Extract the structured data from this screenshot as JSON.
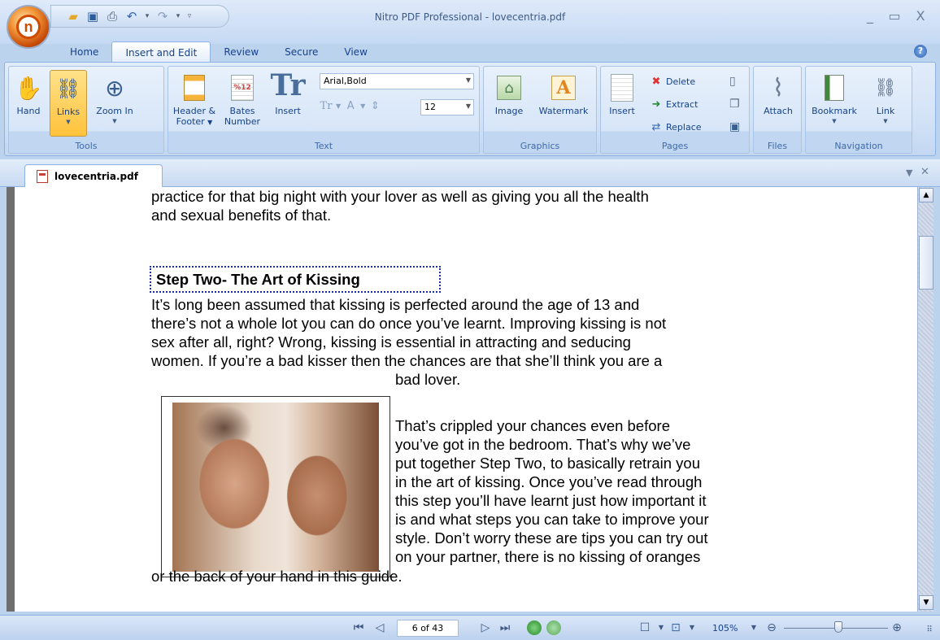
{
  "window": {
    "title": "Nitro PDF Professional - lovecentria.pdf",
    "app_logo": "n",
    "controls": [
      "_",
      "▭",
      "X"
    ]
  },
  "quick_access": {
    "icons": [
      "open-folder-icon",
      "save-icon",
      "print-icon",
      "undo-icon",
      "redo-icon",
      "customize-icon"
    ]
  },
  "ribbon_tabs": [
    "Home",
    "Insert and Edit",
    "Review",
    "Secure",
    "View"
  ],
  "active_tab": "Insert and Edit",
  "ribbon": {
    "tools": {
      "label": "Tools",
      "hand": "Hand",
      "links": "Links",
      "zoom_in": "Zoom In"
    },
    "text": {
      "label": "Text",
      "header_footer_1": "Header &",
      "header_footer_2": "Footer",
      "bates_1": "Bates",
      "bates_2": "Number",
      "bates_icon_text": "%12",
      "insert": "Insert",
      "font_name": "Arial,Bold",
      "font_size": "12"
    },
    "graphics": {
      "label": "Graphics",
      "image": "Image",
      "watermark": "Watermark"
    },
    "pages": {
      "label": "Pages",
      "insert": "Insert",
      "delete": "Delete",
      "extract": "Extract",
      "replace": "Replace"
    },
    "files": {
      "label": "Files",
      "attach": "Attach"
    },
    "navigation": {
      "label": "Navigation",
      "bookmark": "Bookmark",
      "link": "Link"
    }
  },
  "document_tab": {
    "label": "lovecentria.pdf"
  },
  "document": {
    "lines_top": [
      "practice for that big night with your lover as well as giving you all the health",
      "and sexual benefits of that."
    ],
    "heading": "Step Two- The Art of Kissing",
    "paragraph1": [
      "It’s long been assumed that kissing is perfected around the age of 13 and",
      "there’s not a whole lot you can do once you’ve learnt.  Improving kissing is not",
      "sex after all, right?  Wrong, kissing is essential in attracting and seducing",
      "women.  If you’re a bad kisser then the chances are that she’ll think you are  a",
      "bad lover."
    ],
    "paragraph2": [
      "That’s crippled your chances even before",
      "you’ve got in the bedroom.  That’s why we’ve",
      "put together Step Two, to basically retrain you",
      "in the art of kissing.  Once you’ve read through",
      "this step you’ll have learnt just how important it",
      "is and what steps you can take to improve your",
      "style.  Don’t worry these are tips you can try out",
      "on your partner, there is no kissing of oranges"
    ],
    "last_line": "or the back of your hand in this guide."
  },
  "statusbar": {
    "page_indicator": "6 of 43",
    "zoom": "105%"
  }
}
